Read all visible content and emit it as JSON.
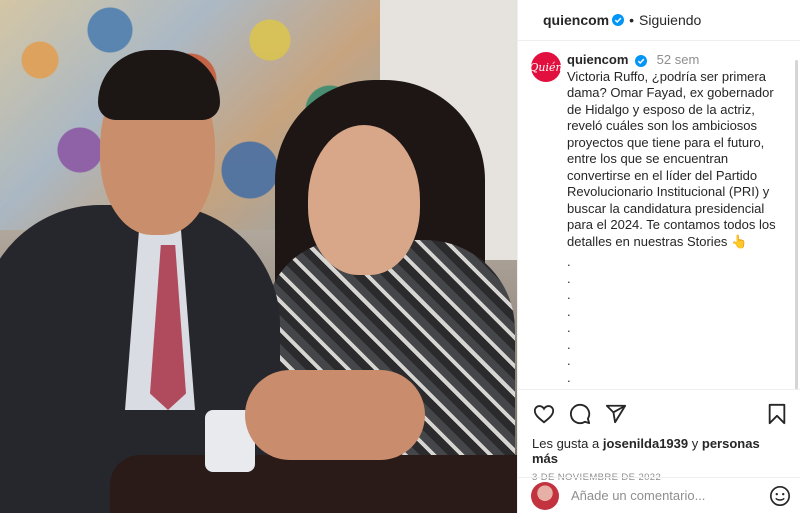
{
  "post": {
    "username": "quiencom",
    "follow_status": "Siguiendo",
    "avatar_text": "Quién",
    "time_ago": "52 sem",
    "caption": "Victoria Ruffo, ¿podría ser primera dama? Omar Fayad, ex gobernador de Hidalgo y esposo de la actriz, reveló cuáles son los ambiciosos proyectos que tiene para el futuro, entre los que se encuentran convertirse en el líder del Partido Revolucionario Institucional (PRI) y buscar la candidatura presidencial para el 2024. Te contamos todos los detalles en nuestras Stories 👆",
    "dots": [
      ".",
      ".",
      ".",
      ".",
      ".",
      ".",
      ".",
      "."
    ],
    "likes_prefix": "Les gusta a",
    "likes_user": "josenilda1939",
    "likes_connector": "y",
    "likes_others": "personas más",
    "date": "3 DE NOVIEMBRE DE 2022",
    "comment_placeholder": "Añade un comentario..."
  },
  "icons": {
    "verified": "verified-badge-icon",
    "like": "heart-icon",
    "comment": "comment-bubble-icon",
    "share": "paper-plane-icon",
    "save": "bookmark-icon",
    "emoji": "smiley-icon"
  },
  "colors": {
    "brand": "#e2103e",
    "verified": "#0095f6",
    "muted": "#8e8e8e",
    "text": "#262626"
  }
}
